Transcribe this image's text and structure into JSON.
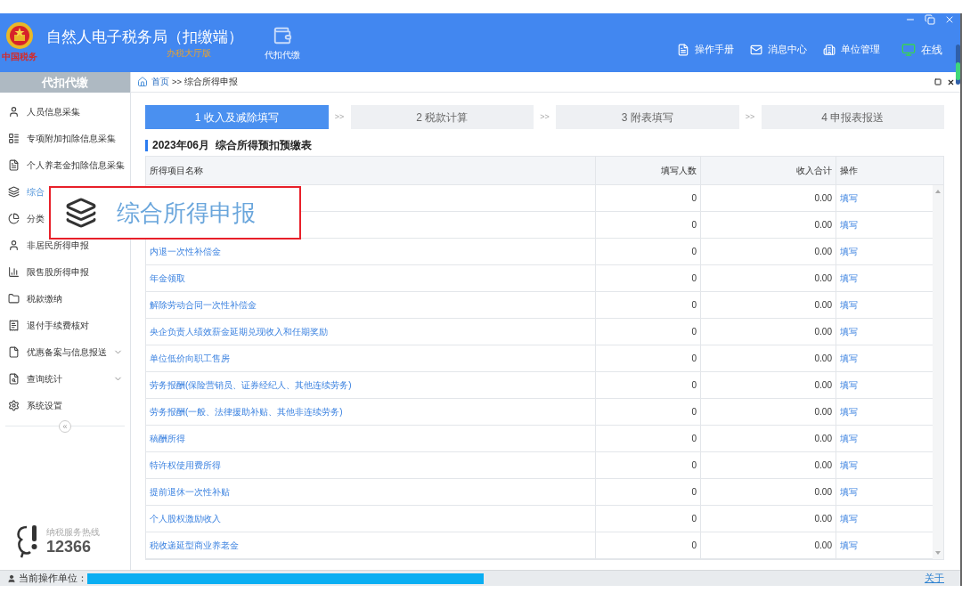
{
  "header": {
    "logo_caption": "中国税务",
    "title": "自然人电子税务局（扣缴端）",
    "edition": "办税大厅版",
    "module": "代扣代缴",
    "tools": [
      {
        "kind": "manual",
        "label": "操作手册"
      },
      {
        "kind": "message",
        "label": "消息中心"
      },
      {
        "kind": "unit",
        "label": "单位管理"
      },
      {
        "kind": "online",
        "label": "在线"
      }
    ]
  },
  "sidebar": {
    "title": "代扣代缴",
    "items": [
      {
        "kind": "person",
        "label": "人员信息采集"
      },
      {
        "kind": "list",
        "label": "专项附加扣除信息采集"
      },
      {
        "kind": "doc",
        "label": "个人养老金扣除信息采集"
      },
      {
        "kind": "layers",
        "label": "综合"
      },
      {
        "kind": "pie",
        "label": "分类"
      },
      {
        "kind": "person",
        "label": "非居民所得申报"
      },
      {
        "kind": "bars",
        "label": "限售股所得申报"
      },
      {
        "kind": "folder",
        "label": "税款缴纳"
      },
      {
        "kind": "receipt",
        "label": "退付手续费核对"
      },
      {
        "kind": "page",
        "label": "优惠备案与信息报送",
        "expandable": true
      },
      {
        "kind": "query",
        "label": "查询统计",
        "expandable": true
      },
      {
        "kind": "gear",
        "label": "系统设置"
      }
    ],
    "collapse": "«",
    "hotline_label": "纳税服务热线",
    "hotline_number": "12366"
  },
  "breadcrumb": {
    "home": "首页",
    "separator": ">>",
    "current": "综合所得申报"
  },
  "steps": [
    {
      "label": "1 收入及减除填写",
      "selected": true
    },
    {
      "label": "2 税款计算",
      "selected": false
    },
    {
      "label": "3 附表填写",
      "selected": false
    },
    {
      "label": "4 申报表报送",
      "selected": false
    }
  ],
  "step_separator": ">>",
  "table_title": "2023年06月  综合所得预扣预缴表",
  "table": {
    "columns": [
      "所得项目名称",
      "填写人数",
      "收入合计",
      "操作"
    ],
    "rows": [
      {
        "count": "0",
        "income": "0.00",
        "action": "填写"
      },
      {
        "count": "0",
        "income": "0.00",
        "action": "填写"
      },
      {
        "name": "内退一次性补偿金",
        "count": "0",
        "income": "0.00",
        "action": "填写"
      },
      {
        "name": "年金领取",
        "count": "0",
        "income": "0.00",
        "action": "填写"
      },
      {
        "name": "解除劳动合同一次性补偿金",
        "count": "0",
        "income": "0.00",
        "action": "填写"
      },
      {
        "name": "央企负责人绩效薪金延期兑现收入和任期奖励",
        "count": "0",
        "income": "0.00",
        "action": "填写"
      },
      {
        "name": "单位低价向职工售房",
        "count": "0",
        "income": "0.00",
        "action": "填写"
      },
      {
        "name": "劳务报酬(保险营销员、证券经纪人、其他连续劳务)",
        "count": "0",
        "income": "0.00",
        "action": "填写"
      },
      {
        "name": "劳务报酬(一般、法律援助补贴、其他非连续劳务)",
        "count": "0",
        "income": "0.00",
        "action": "填写"
      },
      {
        "name": "稿酬所得",
        "count": "0",
        "income": "0.00",
        "action": "填写"
      },
      {
        "name": "特许权使用费所得",
        "count": "0",
        "income": "0.00",
        "action": "填写"
      },
      {
        "name": "提前退休一次性补贴",
        "count": "0",
        "income": "0.00",
        "action": "填写"
      },
      {
        "name": "个人股权激励收入",
        "count": "0",
        "income": "0.00",
        "action": "填写"
      },
      {
        "name": "税收递延型商业养老金",
        "count": "0",
        "income": "0.00",
        "action": "填写"
      }
    ]
  },
  "callout": {
    "label": "综合所得申报"
  },
  "status_bar": {
    "label": "当前操作单位：",
    "about": "关于"
  }
}
